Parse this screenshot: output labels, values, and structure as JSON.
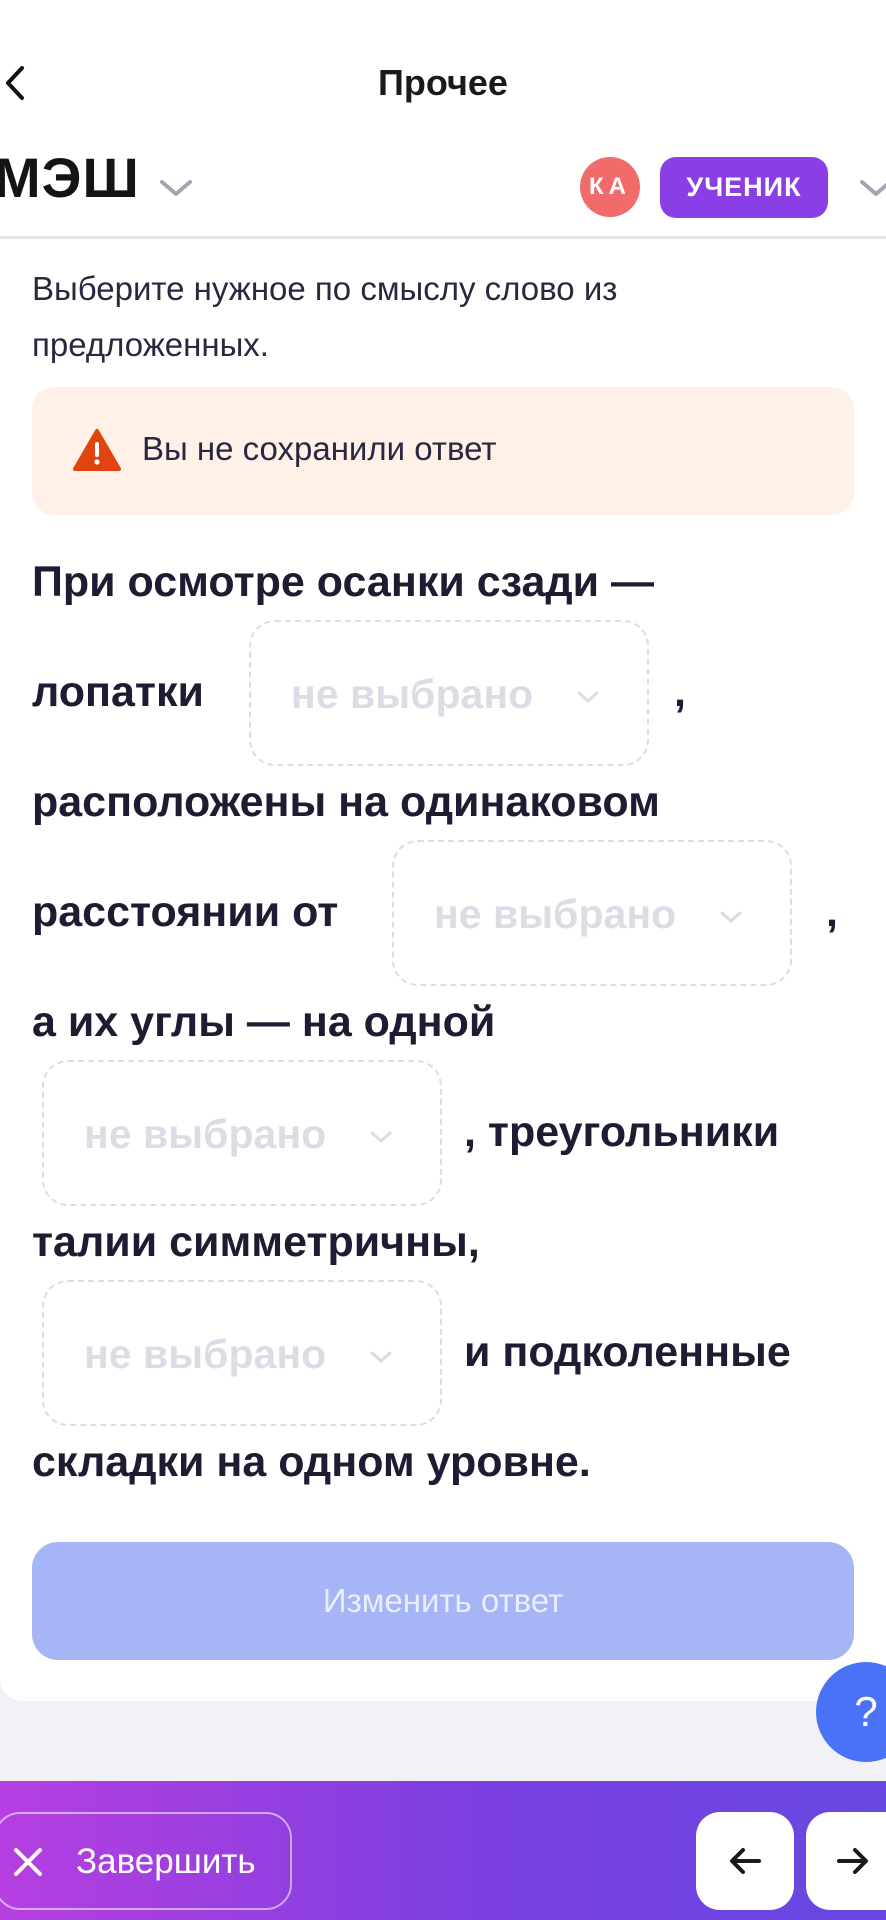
{
  "header": {
    "title": "Прочее",
    "logo": "МЭШ",
    "avatar_initials": "КА",
    "role": "УЧЕНИК"
  },
  "instruction": "Выберите нужное по смыслу слово из предложенных.",
  "warning": {
    "text": "Вы не сохранили ответ"
  },
  "task": {
    "lines": [
      "При осмотре осанки сзади —",
      "лопатки",
      ",",
      "расположены на одинаковом",
      "расстоянии от",
      ",",
      "а их углы — на одной",
      ", треугольники",
      "талии симметричны,",
      "и подколенные",
      "складки на одном уровне."
    ],
    "placeholders": [
      "не выбрано",
      "не выбрано",
      "не выбрано",
      "не выбрано"
    ]
  },
  "buttons": {
    "change_answer": "Изменить ответ",
    "help": "?",
    "finish": "Завершить"
  },
  "colors": {
    "accent": "#8a3fe6",
    "avatar": "#f26b6b",
    "warning_bg": "#fff1e7",
    "warning_icon": "#e0450f",
    "button_disabled": "#a6b5f6",
    "help": "#4a72f6"
  }
}
